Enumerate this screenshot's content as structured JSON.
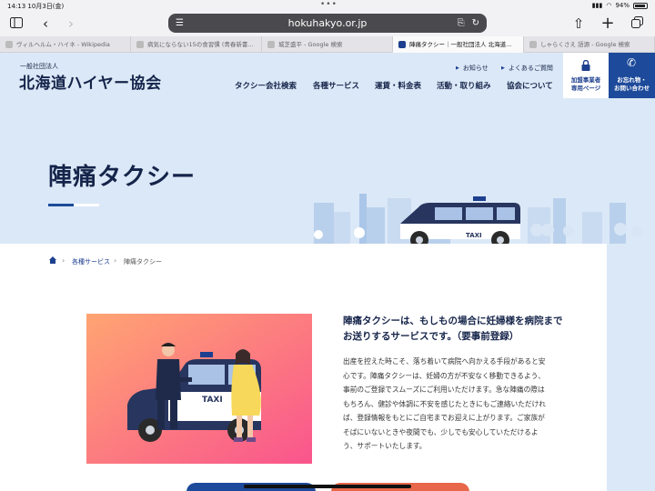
{
  "status_bar": {
    "time": "14:13",
    "date": "10月3日(金)",
    "battery": "94%",
    "dots": "•••"
  },
  "browser": {
    "url": "hokuhakyo.or.jp",
    "tabs": [
      {
        "label": "ヴィルヘルム・ハイネ - Wikipedia",
        "active": false
      },
      {
        "label": "病気にならない15の食習慣 (青春新書…",
        "active": false
      },
      {
        "label": "城芝盛平 - Google 検索",
        "active": false
      },
      {
        "label": "陣痛タクシー｜一般社団法人 北海道…",
        "active": true
      },
      {
        "label": "しゃらくさえ 語源 - Google 検索",
        "active": false
      }
    ]
  },
  "site": {
    "org_type": "一般社団法人",
    "org_name": "北海道ハイヤー協会",
    "util_links": [
      "お知らせ",
      "よくあるご質問"
    ],
    "nav": [
      "タクシー会社検索",
      "各種サービス",
      "運賃・料金表",
      "活動・取り組み",
      "協会について"
    ],
    "member_button": [
      "加盟事業者",
      "専用ページ"
    ],
    "contact_button": [
      "お忘れ物・",
      "お問い合わせ"
    ]
  },
  "hero": {
    "title": "陣痛タクシー",
    "taxi_sign": "TAXI"
  },
  "breadcrumb": [
    "各種サービス",
    "陣痛タクシー"
  ],
  "main": {
    "lead_lines": [
      "陣痛タクシーは、もしもの場合に妊婦様を病院まで",
      "お送りするサービスです。（要事前登録）"
    ],
    "body_lines": [
      "出産を控えた時こそ、落ち着いて病院へ向かえる手段があると安",
      "心です。陣痛タクシーは、妊婦の方が不安なく移動できるよう、",
      "事前のご登録でスムーズにご利用いただけます。急な陣痛の際は",
      "もちろん、健診や体調に不安を感じたときにもご連絡いただけれ",
      "ば、登録情報をもとにご自宅までお迎えに上がります。ご家族が",
      "そばにいないときや夜間でも、少しでも安心していただけるよ",
      "う、サポートいたします。"
    ],
    "illustration_sign": "TAXI"
  },
  "colors": {
    "navy": "#15244a",
    "brand_blue": "#1d4a9a",
    "hero_bg": "#dbe8f7",
    "accent_orange": "#e8674a"
  }
}
